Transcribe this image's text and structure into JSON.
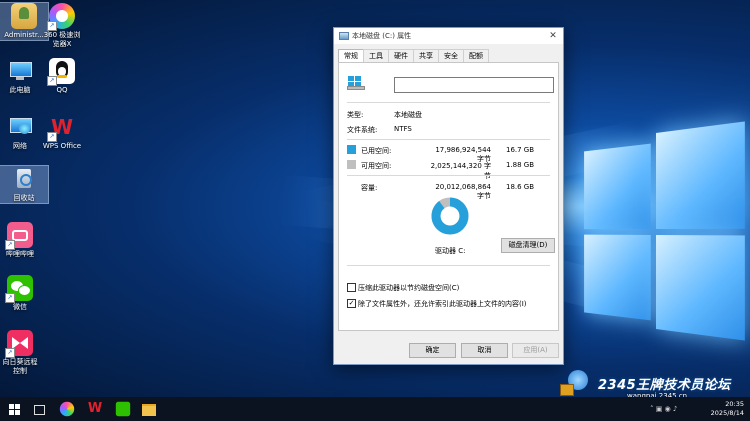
{
  "desktop_icons": [
    {
      "label_lines": [
        "Administr..."
      ]
    },
    {
      "label_lines": [
        "360 极速浏",
        "览器X"
      ]
    },
    {
      "label_lines": [
        "此电脑"
      ]
    },
    {
      "label_lines": [
        "QQ"
      ]
    },
    {
      "label_lines": [
        "网络"
      ]
    },
    {
      "label_lines": [
        "WPS Office"
      ]
    },
    {
      "label_lines": [
        "回收站"
      ]
    },
    {
      "label_lines": [
        "哔哩哔哩"
      ]
    },
    {
      "label_lines": [
        "微信"
      ]
    },
    {
      "label_lines": [
        "向日葵远程",
        "控制"
      ]
    }
  ],
  "dialog": {
    "title": "本地磁盘 (C:) 属性",
    "close": "✕",
    "tabs": [
      "常规",
      "工具",
      "硬件",
      "共享",
      "安全",
      "配额"
    ],
    "name_value": "",
    "type_label": "类型:",
    "type_value": "本地磁盘",
    "fs_label": "文件系统:",
    "fs_value": "NTFS",
    "used_label": "已用空间:",
    "used_bytes": "17,986,924,544 字节",
    "used_gb": "16.7 GB",
    "free_label": "可用空间:",
    "free_bytes": "2,025,144,320 字节",
    "free_gb": "1.88 GB",
    "cap_label": "容量:",
    "cap_bytes": "20,012,068,864 字节",
    "cap_gb": "18.6 GB",
    "drive_label": "驱动器 C:",
    "cleanup_button": "磁盘清理(D)",
    "compress_label": "压缩此驱动器以节约磁盘空间(C)",
    "compress_checked": false,
    "index_label": "除了文件属性外，还允许索引此驱动器上文件的内容(I)",
    "index_checked": true,
    "ok_button": "确定",
    "cancel_button": "取消",
    "apply_button": "应用(A)",
    "used_fraction": 0.899,
    "colors": {
      "used": "#26a0da",
      "free": "#bfbfbf"
    }
  },
  "taskbar": {
    "time": "20:35",
    "date": "2025/8/14"
  },
  "watermark": {
    "brand": "2345王牌技术员论坛",
    "url": "wangpai.2345.cn"
  }
}
